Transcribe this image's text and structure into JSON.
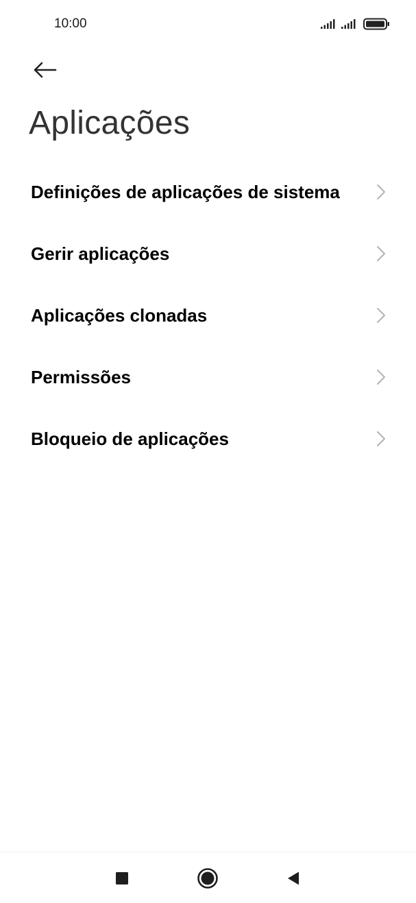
{
  "status_bar": {
    "time": "10:00",
    "icons": [
      "signal-icon",
      "signal-icon",
      "battery-icon"
    ]
  },
  "header": {
    "back_icon": "arrow-left-icon",
    "title": "Aplicações"
  },
  "menu": {
    "items": [
      {
        "label": "Definições de aplicações de sistema",
        "icon": "chevron-right-icon"
      },
      {
        "label": "Gerir aplicações",
        "icon": "chevron-right-icon"
      },
      {
        "label": "Aplicações clonadas",
        "icon": "chevron-right-icon"
      },
      {
        "label": "Permissões",
        "icon": "chevron-right-icon"
      },
      {
        "label": "Bloqueio de aplicações",
        "icon": "chevron-right-icon"
      }
    ]
  },
  "nav_bar": {
    "buttons": [
      "recents-square-icon",
      "home-circle-icon",
      "back-triangle-icon"
    ]
  },
  "colors": {
    "background": "#ffffff",
    "text": "#000000",
    "title": "#333333",
    "chevron": "#b3b3b3"
  }
}
